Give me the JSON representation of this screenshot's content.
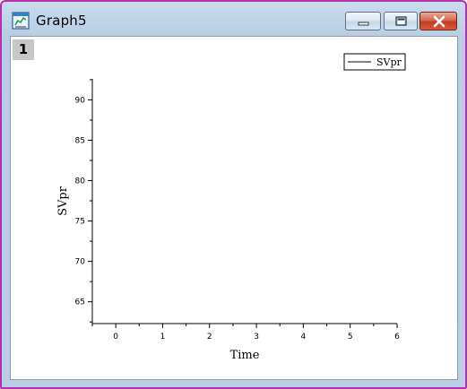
{
  "window": {
    "title": "Graph5",
    "buttons": {
      "minimize": "minimize",
      "maximize": "maximize",
      "close": "close"
    }
  },
  "layer": {
    "number": "1"
  },
  "chart_data": {
    "type": "line",
    "xlabel": "Time",
    "ylabel": "SVpr",
    "xlim": [
      -0.5,
      6.0
    ],
    "ylim": [
      62.3,
      92.6
    ],
    "x_ticks": [
      0,
      1,
      2,
      3,
      4,
      5,
      6
    ],
    "y_ticks": [
      65,
      70,
      75,
      80,
      85,
      90
    ],
    "series": [
      {
        "name": "SVpr",
        "x": [],
        "y": []
      }
    ],
    "legend": {
      "entries": [
        "SVpr"
      ],
      "position": "top-right"
    },
    "grid": false
  },
  "colors": {
    "window_border": "#b62fae",
    "frame": "#b9cfe6",
    "plot_background": "#ffffff",
    "axis": "#000000",
    "layer_badge": "#c7c7c7",
    "close_button": "#c03c1f"
  }
}
